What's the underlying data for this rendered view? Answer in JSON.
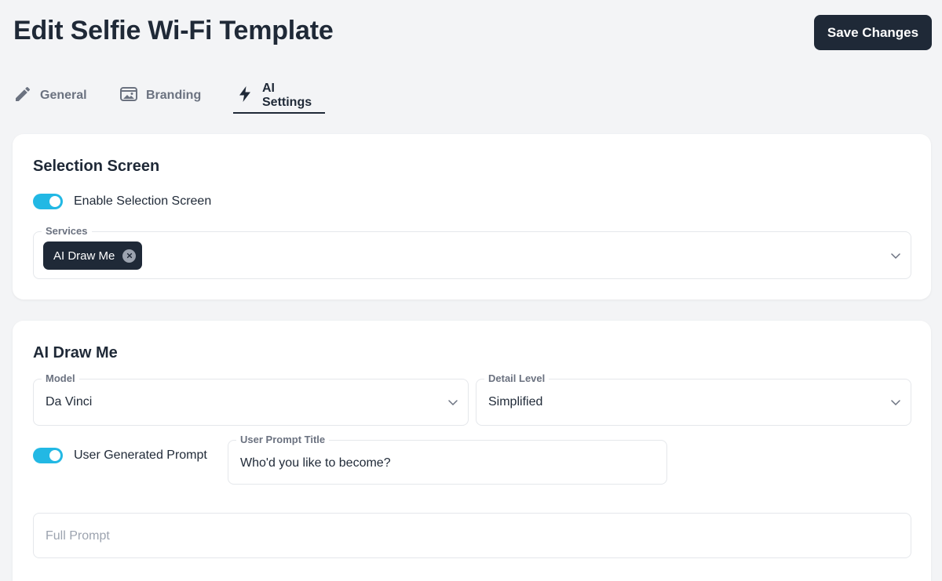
{
  "header": {
    "title": "Edit Selfie Wi-Fi Template",
    "save_label": "Save Changes"
  },
  "tabs": [
    {
      "label": "General",
      "icon": "pencil-icon",
      "active": false
    },
    {
      "label": "Branding",
      "icon": "image-icon",
      "active": false
    },
    {
      "label": "AI Settings",
      "icon": "bolt-icon",
      "active": true
    }
  ],
  "selection_screen": {
    "title": "Selection Screen",
    "toggle_label": "Enable Selection Screen",
    "toggle_on": true,
    "services_legend": "Services",
    "services_selected": [
      "AI Draw Me"
    ]
  },
  "ai_draw_me": {
    "title": "AI Draw Me",
    "model_legend": "Model",
    "model_value": "Da Vinci",
    "detail_legend": "Detail Level",
    "detail_value": "Simplified",
    "user_prompt_toggle_label": "User Generated Prompt",
    "user_prompt_toggle_on": true,
    "user_prompt_title_legend": "User Prompt Title",
    "user_prompt_title_value": "Who'd you like to become?",
    "full_prompt_placeholder": "Full Prompt"
  },
  "colors": {
    "accent": "#22b8e4",
    "dark": "#1f2937",
    "muted": "#6b7280"
  }
}
